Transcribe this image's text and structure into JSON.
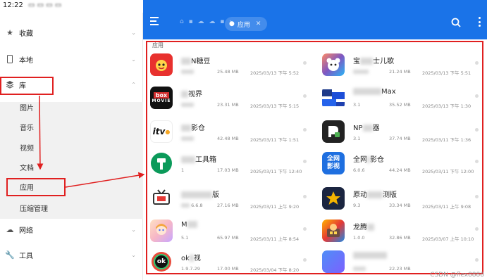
{
  "statusbar": {
    "time": "12:22"
  },
  "drawer": {
    "items": [
      {
        "label": "收藏",
        "icon": "star-icon"
      },
      {
        "label": "本地",
        "icon": "phone-icon"
      },
      {
        "label": "库",
        "icon": "layers-icon"
      }
    ],
    "sub_items": [
      "图片",
      "音乐",
      "视频",
      "文档",
      "应用",
      "压缩管理"
    ],
    "bottom_items": [
      {
        "label": "网络",
        "icon": "network-icon"
      },
      {
        "label": "工具",
        "icon": "wrench-icon"
      }
    ]
  },
  "topbar": {
    "chip_label": "应用"
  },
  "content": {
    "section_label": "应用"
  },
  "apps_left": [
    {
      "name_pre": "",
      "name_post": "N糖豆",
      "size": "25.48 MB",
      "date": "2025/03/13 下午 5:52",
      "ver": ""
    },
    {
      "name_pre": "",
      "name_post": "视界",
      "size": "23.31 MB",
      "date": "2025/03/13 下午 5:15",
      "ver": ""
    },
    {
      "name_pre": "",
      "name_post": "影仓",
      "size": "42.48 MB",
      "date": "2025/03/11 下午 1:51",
      "ver": ""
    },
    {
      "name_pre": "",
      "name_post": "工具箱",
      "size": "17.03 MB",
      "date": "2025/03/11 下午 12:40",
      "ver": "1"
    },
    {
      "name_pre": "",
      "name_post": "版",
      "size": "27.16 MB",
      "date": "2025/03/11 上午 9:20",
      "ver": "6.6.8"
    },
    {
      "name_pre": "M",
      "name_post": "",
      "size": "65.97 MB",
      "date": "2025/03/11 上午 8:54",
      "ver": "5.1"
    },
    {
      "name_pre": "ok",
      "name_post": "视",
      "size": "17.00 MB",
      "date": "2025/03/04 下午 8:20",
      "ver": "1.9.7.29"
    }
  ],
  "apps_right": [
    {
      "name_pre": "宝",
      "name_post": "士儿歌",
      "size": "21.24 MB",
      "date": "2025/03/13 下午 5:51",
      "ver": ""
    },
    {
      "name_pre": "",
      "name_post": "Max",
      "size": "35.52 MB",
      "date": "2025/03/13 下午 1:30",
      "ver": "3.1"
    },
    {
      "name_pre": "NP",
      "name_post": "器",
      "size": "37.74 MB",
      "date": "2025/03/11 下午 1:36",
      "ver": "3.1"
    },
    {
      "name_pre": "全网",
      "name_post": "影仓",
      "size": "44.24 MB",
      "date": "2025/03/11 下午 12:00",
      "ver": "6.0.6"
    },
    {
      "name_pre": "原动",
      "name_post": "测版",
      "size": "33.34 MB",
      "date": "2025/03/11 上午 9:08",
      "ver": "9.3"
    },
    {
      "name_pre": "龙腾",
      "name_post": "",
      "size": "32.86 MB",
      "date": "2025/03/07 上午 10:10",
      "ver": "1.0.0"
    },
    {
      "name_pre": "",
      "name_post": "",
      "size": "22.23 MB",
      "date": "",
      "ver": ""
    }
  ],
  "icon_text": {
    "box": "box",
    "movie": "MOVIE",
    "itv": "itv",
    "qw1": "全网",
    "qw2": "影视",
    "ok": "ok"
  },
  "watermark": "CSDN @flex8888"
}
